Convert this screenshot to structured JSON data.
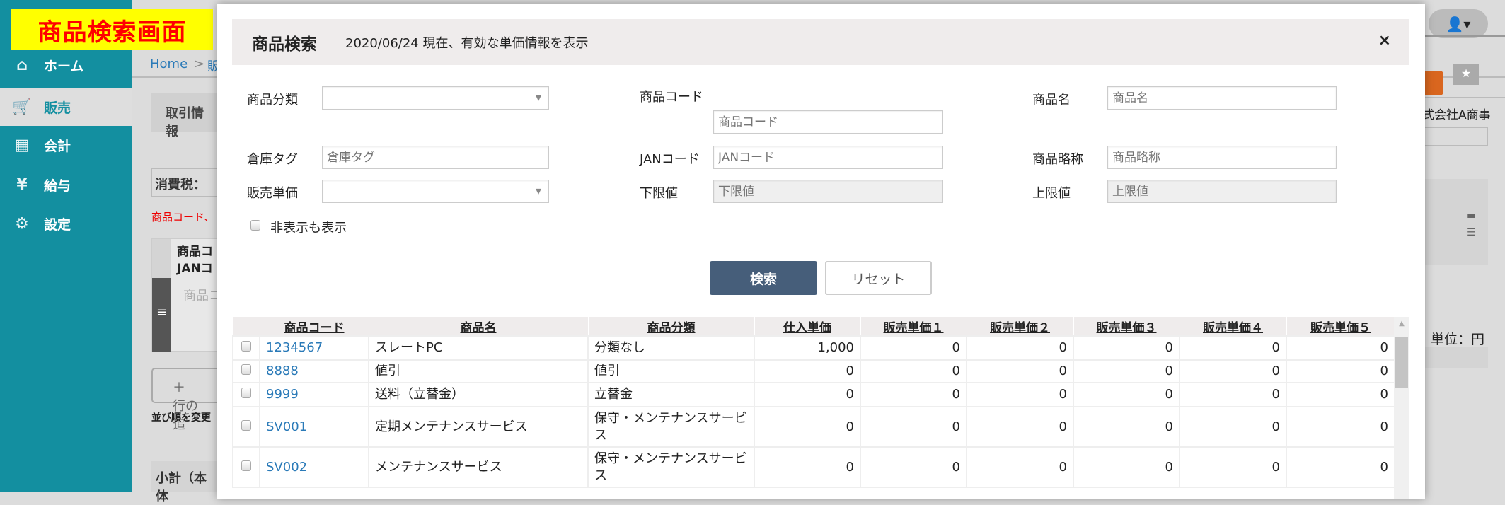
{
  "annotation_label": "商品検索画面",
  "sidebar": {
    "items": [
      {
        "label": "ホーム",
        "icon": "home-icon",
        "glyph": "⌂"
      },
      {
        "label": "販売",
        "icon": "cart-icon",
        "glyph": "🛒"
      },
      {
        "label": "会計",
        "icon": "calculator-icon",
        "glyph": "▦"
      },
      {
        "label": "給与",
        "icon": "money-bag-icon",
        "glyph": "¥"
      },
      {
        "label": "設定",
        "icon": "gear-icon",
        "glyph": "⚙"
      }
    ],
    "active": 1
  },
  "background": {
    "breadcrumb_home": "Home",
    "breadcrumb_sep": ">",
    "breadcrumb_next": "販",
    "tab": "取引情報",
    "tax": "消費税：",
    "red_note": "商品コード、",
    "grid_header1": "商品コ",
    "grid_header2": "JANコ",
    "grid_placeholder": "商品コ",
    "add_row": "＋ 行の追",
    "sort_note": "並び順を変更",
    "subtotal": "小計（本体",
    "customer": "式会社A商事",
    "unit": "単位：円"
  },
  "modal": {
    "title": "商品検索",
    "subtitle": "2020/06/24 現在、有効な単価情報を表示",
    "close": "×",
    "fields": {
      "category": {
        "label": "商品分類",
        "value": ""
      },
      "code": {
        "label": "商品コード",
        "placeholder": "商品コード"
      },
      "name": {
        "label": "商品名",
        "placeholder": "商品名"
      },
      "warehouse_tag": {
        "label": "倉庫タグ",
        "placeholder": "倉庫タグ"
      },
      "jan": {
        "label": "JANコード",
        "placeholder": "JANコード"
      },
      "short_name": {
        "label": "商品略称",
        "placeholder": "商品略称"
      },
      "sale_price": {
        "label": "販売単価",
        "value": ""
      },
      "min": {
        "label": "下限値",
        "placeholder": "下限値"
      },
      "max": {
        "label": "上限値",
        "placeholder": "上限値"
      },
      "show_hidden": {
        "label": "非表示も表示",
        "checked": false
      }
    },
    "search_button": "検索",
    "reset_button": "リセット",
    "table": {
      "columns": [
        "商品コード",
        "商品名",
        "商品分類",
        "仕入単価",
        "販売単価１",
        "販売単価２",
        "販売単価３",
        "販売単価４",
        "販売単価５"
      ],
      "rows": [
        [
          "1234567",
          "スレートPC",
          "分類なし",
          "1,000",
          "0",
          "0",
          "0",
          "0",
          "0"
        ],
        [
          "8888",
          "値引",
          "値引",
          "0",
          "0",
          "0",
          "0",
          "0",
          "0"
        ],
        [
          "9999",
          "送料（立替金）",
          "立替金",
          "0",
          "0",
          "0",
          "0",
          "0",
          "0"
        ],
        [
          "SV001",
          "定期メンテナンスサービス",
          "保守・メンテナンスサービス",
          "0",
          "0",
          "0",
          "0",
          "0",
          "0"
        ],
        [
          "SV002",
          "メンテナンスサービス",
          "保守・メンテナンスサービス",
          "0",
          "0",
          "0",
          "0",
          "0",
          "0"
        ]
      ]
    }
  },
  "colors": {
    "sidebar": "#138fa0",
    "primary_button": "#465e7a",
    "link": "#2a7ab8",
    "accent_orange": "#d9661f",
    "stamp_bg": "#ffff00",
    "stamp_text": "#ff0000"
  }
}
